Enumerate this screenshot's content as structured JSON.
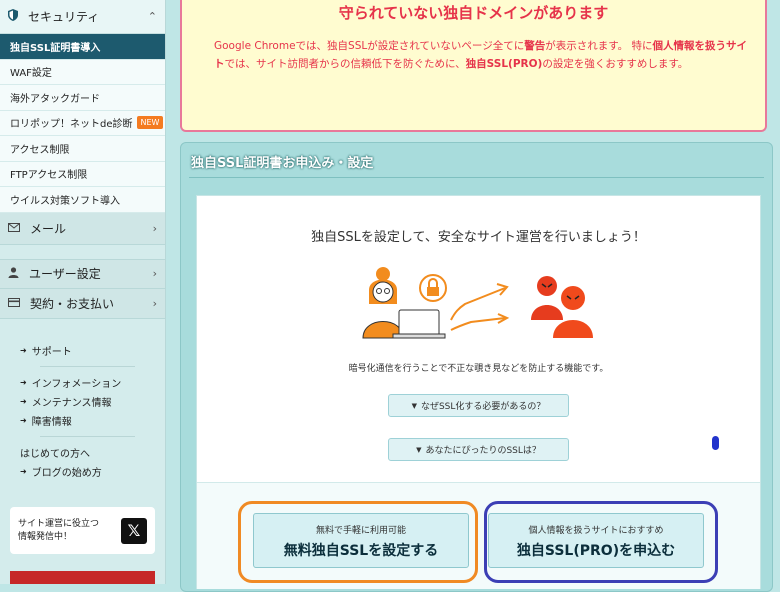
{
  "sidebar": {
    "security": {
      "label": "セキュリティ"
    },
    "security_items": [
      {
        "label": "独自SSL証明書導入",
        "active": true
      },
      {
        "label": "WAF設定"
      },
      {
        "label": "海外アタックガード"
      },
      {
        "label": "ロリポップ！ネットde診断",
        "badge": "NEW"
      },
      {
        "label": "アクセス制限"
      },
      {
        "label": "FTPアクセス制限"
      },
      {
        "label": "ウイルス対策ソフト導入"
      }
    ],
    "categories": [
      {
        "label": "メール"
      },
      {
        "label": "ユーザー設定"
      },
      {
        "label": "契約・お支払い"
      }
    ],
    "links_group1": [
      "サポート"
    ],
    "links_group2": [
      "インフォメーション",
      "メンテナンス情報",
      "障害情報"
    ],
    "links_group3_plain": "はじめての方へ",
    "links_group3": [
      "ブログの始め方"
    ],
    "promo": {
      "line1": "サイト運営に役立つ",
      "line2": "情報発信中！"
    }
  },
  "warning": {
    "title": "守られていない独自ドメインがあります",
    "p1": "Google Chromeでは、独自SSLが設定されていないページ全てに",
    "p1_em": "警告",
    "p2": "が表示されます。 特に",
    "p2_em": "個人情報を扱うサイト",
    "p3": "では、サイト訪問者からの信頼低下を防ぐために、",
    "p3_em": "独自SSL(PRO)",
    "p4": "の設定を強くおすすめします。"
  },
  "panel": {
    "title": "独自SSL証明書お申込み・設定",
    "lead": "独自SSLを設定して、安全なサイト運営を行いましょう！",
    "desc": "暗号化通信を行うことで不正な覗き見などを防止する機能です。",
    "accordion1": "なぜSSL化する必要があるの？",
    "accordion2": "あなたにぴったりのSSLは？",
    "cta_free": {
      "small": "無料で手軽に利用可能",
      "big": "無料独自SSLを設定する"
    },
    "cta_pro": {
      "small": "個人情報を扱うサイトにおすすめ",
      "big": "独自SSL(PRO)を申込む"
    }
  },
  "colors": {
    "accent_dark": "#1d5a6e",
    "warning_red": "#e6334a",
    "orange_ring": "#f08a24",
    "blue_ring": "#3c3fb5",
    "badge": "#f47b20"
  }
}
